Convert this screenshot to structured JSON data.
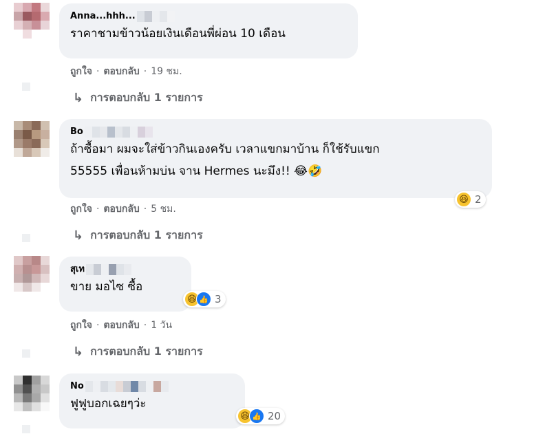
{
  "comments": [
    {
      "author": "Anna...hhh...",
      "text": "ราคาชามข้าวน้อยเงินเดือนพี่ผ่อน 10 เดือน",
      "like": "ถูกใจ",
      "reply": "ตอบกลับ",
      "time": "19 ชม.",
      "replies": "การตอบกลับ 1 รายการ",
      "avatar_colors": [
        "#e8ccd0",
        "#d8a8b0",
        "#c27880",
        "#ead8da",
        "#c8a4a8",
        "#9a5a60",
        "#b56a70",
        "#d9aab0",
        "#e8d0d4",
        "#d4b0b4",
        "#c89098",
        "#e8d4d8",
        "#fff",
        "#f0dde0",
        "#fff",
        "#fff"
      ]
    },
    {
      "author": "Bo",
      "text": "ถ้าซื้อมา ผมจะใส่ข้าวกินเองครับ เวลาแขกมาบ้าน ก็ใช้รับแขก\n55555 เพื่อนห้ามบ่น จาน Hermes นะมึง!! 😂🤣",
      "like": "ถูกใจ",
      "reply": "ตอบกลับ",
      "time": "5 ชม.",
      "replies": "การตอบกลับ 1 รายการ",
      "reaction_count": "2",
      "avatar_colors": [
        "#c8b8a8",
        "#a88c78",
        "#8a6a58",
        "#d0c0b0",
        "#9a8070",
        "#7a5a48",
        "#b89a80",
        "#c8b0a0",
        "#b09888",
        "#9a7a68",
        "#8a6a58",
        "#d8c8b8",
        "#e8e0d8",
        "#c0a898",
        "#d8c8b8",
        "#f0ece8"
      ]
    },
    {
      "author": "สุเท",
      "text": "ขาย มอไซ ซื้อ",
      "like": "ถูกใจ",
      "reply": "ตอบกลับ",
      "time": "1 วัน",
      "replies": "การตอบกลับ 1 รายการ",
      "reaction_count": "3",
      "avatar_colors": [
        "#e0c8c8",
        "#c8a0a0",
        "#b88888",
        "#e8d8d8",
        "#d0b0b0",
        "#b89090",
        "#c89898",
        "#d8c0c0",
        "#c8b0b0",
        "#b09898",
        "#d0b8b8",
        "#e8d8d8",
        "#f0e8e8",
        "#d8c8c8",
        "#f0e8e8",
        "#fff"
      ]
    },
    {
      "author": "No",
      "text": "ฟูฟูบอกเฉยๆว่ะ",
      "reaction_count": "20",
      "avatar_colors": [
        "#c8c8c8",
        "#303030",
        "#a0a0a0",
        "#d8d8d8",
        "#909090",
        "#505050",
        "#b0b0b0",
        "#c8c8c8",
        "#b8b8b8",
        "#787878",
        "#a8a8a8",
        "#e0e0e0",
        "#e8e8e8",
        "#c0c0c0",
        "#e0e0e0",
        "#f8f8f8"
      ]
    }
  ]
}
